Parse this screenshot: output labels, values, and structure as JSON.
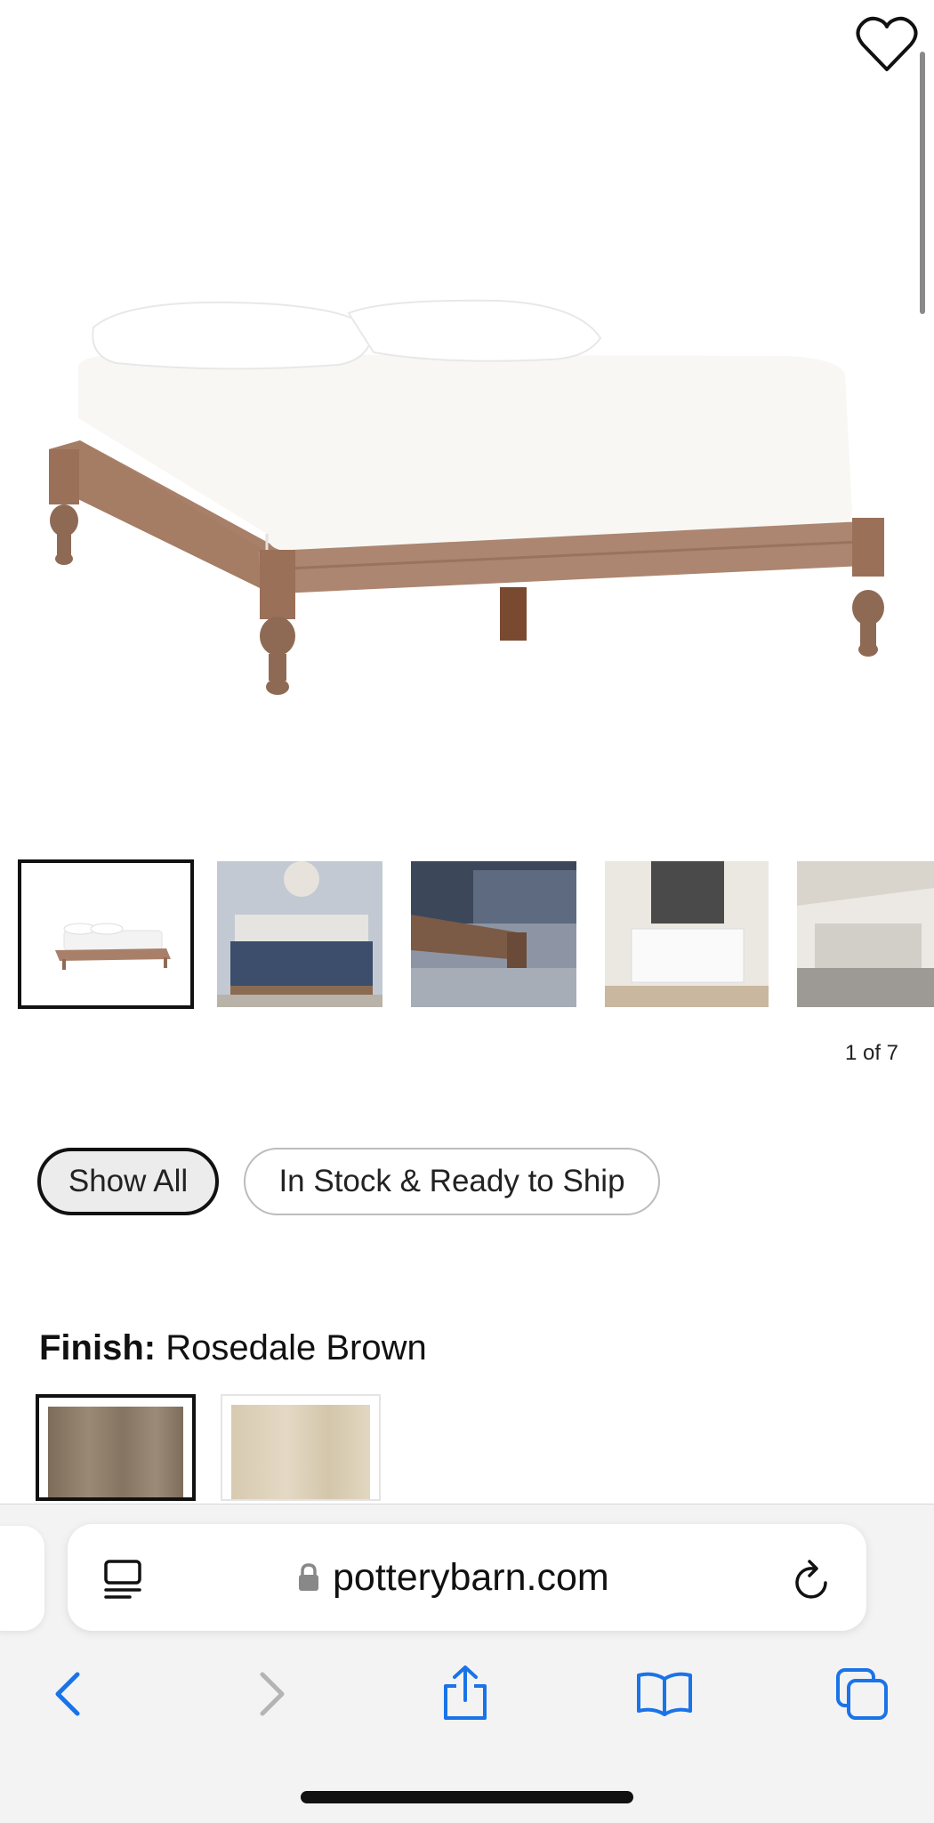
{
  "product": {
    "gallery_counter": "1 of 7",
    "thumbnail_count": 5,
    "selected_thumbnail": 1
  },
  "filters": {
    "show_all": "Show All",
    "in_stock": "In Stock & Ready to Ship"
  },
  "finish": {
    "label": "Finish:",
    "value": "Rosedale Brown",
    "swatch_colors": [
      "#8a7a66",
      "#d8ccb2"
    ]
  },
  "browser": {
    "url": "potterybarn.com",
    "accent_color": "#1a73e8",
    "icons": [
      "reader-icon",
      "lock-icon",
      "reload-icon",
      "back-icon",
      "forward-icon",
      "share-icon",
      "bookmarks-icon",
      "tabs-icon"
    ]
  },
  "colors": {
    "wood": "#a07860",
    "sheet": "#f7f6f3"
  }
}
